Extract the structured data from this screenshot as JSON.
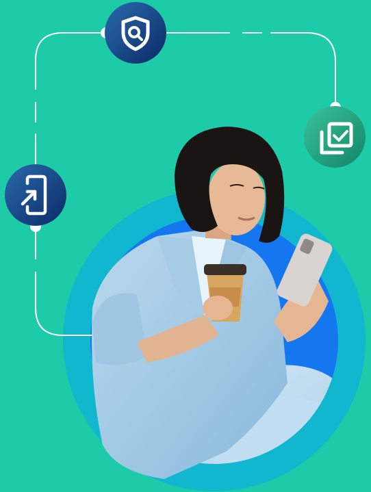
{
  "colors": {
    "background": "#1ecba8",
    "line": "#ffffff",
    "outer_ring": "#10b7d0",
    "inner_circle": "#1577f0",
    "icon_navy_light": "#1f5f9f",
    "icon_navy_dark": "#0d2f6b",
    "icon_green_light": "#2fb891",
    "icon_green_dark": "#138b6d"
  },
  "icons": [
    {
      "name": "shield-search-icon"
    },
    {
      "name": "checklist-copy-icon"
    },
    {
      "name": "device-login-icon"
    }
  ],
  "photo": {
    "subject": "woman-with-phone-and-coffee"
  }
}
